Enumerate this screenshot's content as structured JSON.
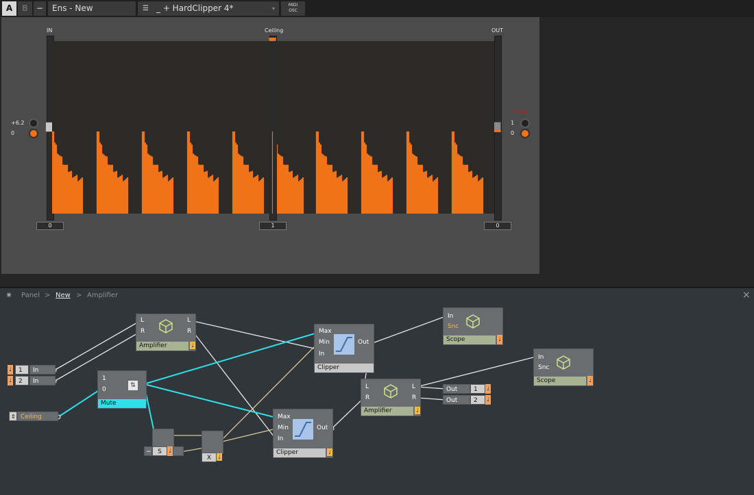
{
  "topbar": {
    "tab_a": "A",
    "tab_b": "B",
    "minus": "−",
    "ensemble_name": "Ens - New",
    "instrument_name": "_ + HardClipper 4*",
    "midi_osc_line1": "MIDI",
    "midi_osc_line2": "OSC"
  },
  "panel": {
    "in_label": "IN",
    "ceiling_label": "Ceiling",
    "out_label": "OUT",
    "in_value": "0",
    "ceiling_value": "1",
    "out_value": "0",
    "left_knob_top_label": "+6.2",
    "left_knob_bottom_label": "0",
    "right_knob_top_label": "1",
    "right_knob_bottom_label": "0",
    "right_red_label": "Mute"
  },
  "breadcrumb": {
    "items": [
      "Panel",
      "New",
      "Amplifier"
    ],
    "sep": ">",
    "close": "×"
  },
  "modules": {
    "amplifier1": {
      "name": "Amplifier",
      "in_l": "L",
      "in_r": "R",
      "out_l": "L",
      "out_r": "R"
    },
    "clipper1": {
      "name": "Clipper",
      "max": "Max",
      "min": "Min",
      "in": "In",
      "out": "Out"
    },
    "scope1": {
      "name": "Scope",
      "in": "In",
      "snc": "Snc"
    },
    "amplifier2": {
      "name": "Amplifier",
      "in_l": "L",
      "in_r": "R",
      "out_l": "L",
      "out_r": "R"
    },
    "scope2": {
      "name": "Scope",
      "in": "In",
      "snc": "Snc"
    },
    "mute": {
      "name": "Mute",
      "p1": "1",
      "p0": "0"
    },
    "clipper2": {
      "name": "Clipper",
      "max": "Max",
      "min": "Min",
      "in": "In",
      "out": "Out"
    },
    "ceiling": {
      "name": "Ceiling"
    },
    "s_module": {
      "name": "S",
      "minus": "−"
    },
    "x_module": {
      "name": "X"
    },
    "in1": {
      "num": "1",
      "label": "In"
    },
    "in2": {
      "num": "2",
      "label": "In"
    },
    "out1": {
      "num": "1",
      "label": "Out"
    },
    "out2": {
      "num": "2",
      "label": "Out"
    }
  },
  "colors": {
    "orange": "#f0731a",
    "cyan": "#2ee0e8",
    "panel_bg": "#4b4b4b",
    "struct_bg": "#31363b"
  },
  "icons": {
    "logo": "gear-icon",
    "list": "list-icon",
    "module": "cube-icon"
  }
}
